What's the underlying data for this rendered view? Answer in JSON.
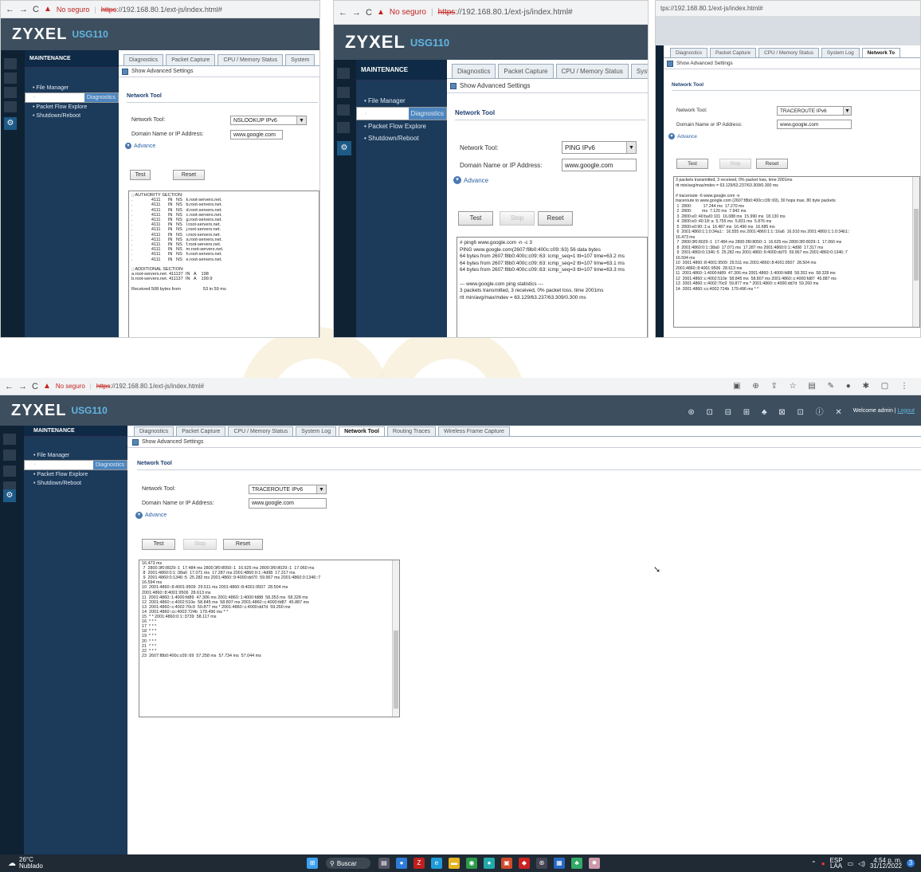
{
  "browser": {
    "back": "←",
    "forward": "→",
    "reload": "C",
    "not_secure": "No seguro",
    "https": "https",
    "url_rest": "://192.168.80.1/ext-js/index.html#",
    "url_partial": "tps://192.168.80.1/ext-js/index.html#"
  },
  "brand": {
    "name": "ZYXEL",
    "model": "USG110"
  },
  "sidebar": {
    "title": "MAINTENANCE",
    "items": [
      "File Manager",
      "Diagnostics",
      "Packet Flow Explore",
      "Shutdown/Reboot"
    ]
  },
  "tabs": [
    "Diagnostics",
    "Packet Capture",
    "CPU / Memory Status",
    "System Log",
    "Network Tool",
    "Routing Traces",
    "Wireless Frame Capture"
  ],
  "tabs_short": [
    "Diagnostics",
    "Packet Capture",
    "CPU / Memory Status",
    "System"
  ],
  "tabs_panel3": [
    "Diagnostics",
    "Packet Capture",
    "CPU / Memory Status",
    "System Log",
    "Network To"
  ],
  "advanced_settings": "Show Advanced Settings",
  "section_title": "Network Tool",
  "form": {
    "tool_label": "Network Tool:",
    "domain_label": "Domain Name or IP Address:",
    "domain_value": "www.google.com",
    "advance": "Advance",
    "test": "Test",
    "stop": "Stop",
    "reset": "Reset"
  },
  "panel1": {
    "tool_value": "NSLOOKUP IPv6",
    "lines": [
      ";; AUTHORITY SECTION:",
      ".               4111      IN   NS   k.root-servers.net.",
      ".               4111      IN   NS   b.root-servers.net.",
      ".               4111      IN   NS   d.root-servers.net.",
      ".               4111      IN   NS   c.root-servers.net.",
      ".               4111      IN   NS   g.root-servers.net.",
      ".               4111      IN   NS   l.root-servers.net.",
      ".               4111      IN   NS   j.root-servers.net.",
      ".               4111      IN   NS   i.root-servers.net.",
      ".               4111      IN   NS   a.root-servers.net.",
      ".               4111      IN   NS   f.root-servers.net.",
      ".               4111      IN   NS   m.root-servers.net.",
      ".               4111      IN   NS   h.root-servers.net.",
      ".               4111      IN   NS   e.root-servers.net.",
      "",
      ";; ADDITIONAL SECTION:",
      "a.root-servers.net. 411137  IN   A    198",
      "b.root-servers.net. 411137  IN   A    199.9",
      "",
      "Received 508 bytes from                  53 in 59 ms"
    ]
  },
  "panel2": {
    "tool_value": "PING IPv6",
    "lines": [
      "# ping6 www.google.com -n -c 3",
      "PING www.google.com(2607:f8b0:400c:c09::63) 56 data bytes",
      "64 bytes from 2607:f8b0:400c:c09::63: icmp_seq=1 ttl=107 time=63.2 ms",
      "64 bytes from 2607:f8b0:400c:c09::63: icmp_seq=2 ttl=107 time=63.1 ms",
      "64 bytes from 2607:f8b0:400c:c09::63: icmp_seq=3 ttl=107 time=63.3 ms",
      "",
      "--- www.google.com ping statistics ---",
      "3 packets transmitted, 3 received, 0% packet loss, time 2001ms",
      "rtt min/avg/max/mdev = 63.129/63.237/63.309/0.300 ms"
    ]
  },
  "panel3": {
    "tool_value": "TRACEROUTE IPv6",
    "lines": [
      "3 packets transmitted, 3 received, 0% packet loss, time 2001ms",
      "rtt min/avg/max/mdev = 63.129/63.237/63.309/0.300 ms",
      "",
      "# traceroute -6 www.google.com -n",
      "traceroute to www.google.com (2607:f8b0:400c:c09::69), 30 hops max, 80 byte packets",
      " 1  2800:          17.244 ms  17.270 ms",
      " 2  2800:         ms  7.120 ms  7.942 ms",
      " 3  2800:e0::40:ba!0:101  16.088 ms  15.990 ms  18.130 ms",
      " 4  2800:e0::40:18::a  5.755 ms  5.831 ms  5.876 ms",
      " 5  2800:e0:90::1:a  16.487 ms  16.496 ms  16.685 ms",
      " 6  2001:4860:1:1:0:34a1::  16.555 ms 2001:4860:1:1::16a6  16.910 ms 2001:4860:1:1:0:34b1::",
      "16.473 ms",
      " 7  2800:3f0:8029::1  17.484 ms 2800:3f0:8050::1  16.625 ms 2800:3f0:8029::1  17.060 ms",
      " 8  2001:4860:0:1::38a0  17.071 ms  17.287 ms 2001:4860:0:1::4d98  17.317 ms",
      " 9  2001:4860:0:1346::5  25.282 ms 2001:4860::9:4000:dd70  59.967 ms 2001:4860:0:1346::7",
      "16.594 ms",
      "10  2001:4860::8:4001:9509  29.511 ms 2001:4860::8:4001:9507  28.504 ms",
      "2001:4860::8:4001:9506  28.613 ms",
      "11  2001:4860::1:4000:fd89  47.306 ms 2001:4860::1:4000:fd88  58.353 ms  58.328 ms",
      "12  2001:4860::c:4002:510e  58.845 ms  58.807 ms 2001:4860::c:4000:fd87  45.887 ms",
      "13  2001:4860::c:4002:70c9  59.877 ms * 2001:4860::c:4000:dd7d  59.260 ms",
      "14  2001:4860::cc:4002:724b  179.496 ms * *"
    ]
  },
  "main": {
    "tool_value": "TRACEROUTE IPv6",
    "welcome": "Welcome",
    "user": "admin",
    "logout": "Logout",
    "lines": [
      "16.473 ms",
      " 7  2800:3f0:8029::1  17.484 ms 2800:3f0:8050::1  16.625 ms 2800:3f0:8029::1  17.060 ms",
      " 8  2001:4860:0:1::38a0  17.071 ms  17.287 ms 2001:4860:0:1::4d98  17.317 ms",
      " 9  2001:4860:0:1346::5  25.282 ms 2001:4860::9:4000:dd70  59.967 ms 2001:4860:0:1346::7",
      "16.594 ms",
      "10  2001:4860::8:4001:9509  29.511 ms 2001:4860::8:4001:9507  28.504 ms",
      "2001:4860::8:4001:9506  28.613 ms",
      "11  2001:4860::1:4000:fd89  47.306 ms 2001:4860::1:4000:fd88  58.353 ms  58.328 ms",
      "12  2001:4860::c:4002:510e  58.845 ms  58.807 ms 2001:4860::c:4000:fd87  45.887 ms",
      "13  2001:4860::c:4002:70c9  59.877 ms * 2001:4860::c:4000:dd7d  59.260 ms",
      "14  2001:4860::cc:4002:724b  179.496 ms * *",
      "15  * * 2001:4860:0:1::3739  58.117 ms",
      "16  * * *",
      "17  * * *",
      "18  * * *",
      "19  * * *",
      "20  * * *",
      "21  * * *",
      "22  * * *",
      "23  2607:f8b0:400c:c09::69  57.258 ms  57.734 ms  57.044 ms"
    ]
  },
  "taskbar": {
    "weather_temp": "26°C",
    "weather_desc": "Nublado",
    "search": "Buscar",
    "lang1": "ESP",
    "lang2": "LAA",
    "time": "4:54 p. m.",
    "date": "31/12/2022"
  }
}
